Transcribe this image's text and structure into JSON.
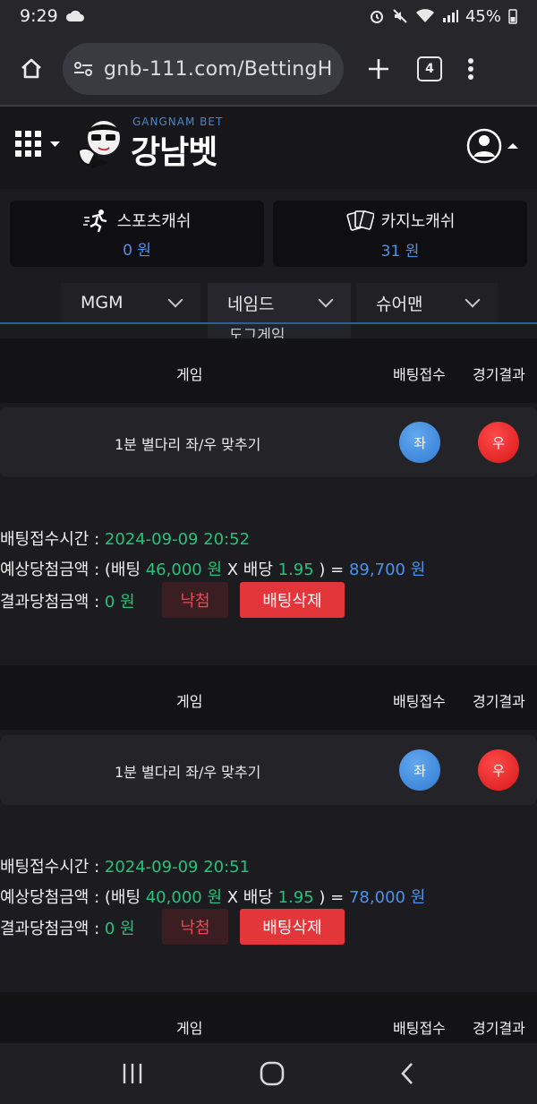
{
  "status_bar": {
    "time": "9:29",
    "battery": "45%"
  },
  "browser": {
    "url": "gnb-111.com/BettingH",
    "tab_count": "4"
  },
  "site": {
    "logo_sub": "GANGNAM BET",
    "logo_main": "강남벳"
  },
  "cash": [
    {
      "label": "스포츠캐쉬",
      "value": "0 원"
    },
    {
      "label": "카지노캐쉬",
      "value": "31 원"
    }
  ],
  "filters": [
    "MGM",
    "네임드",
    "슈어맨"
  ],
  "dropdown_peek": "도그게임",
  "table_headers": {
    "game": "게임",
    "betting": "배팅접수",
    "result": "경기결과"
  },
  "bets": [
    {
      "game_name": "1분 별다리 좌/우 맞추기",
      "left_label": "좌",
      "right_label": "우",
      "time_label": "배팅접수시간 : ",
      "time_value": "2024-09-09 20:52",
      "expected_label": "예상당첨금액 : (배팅 ",
      "bet_amount": "46,000 원",
      "x_label": " X 배당 ",
      "odds": "1.95",
      "eq_label": " ) = ",
      "payout": "89,700 원",
      "result_label": "결과당첨금액 : ",
      "result_value": "0 원",
      "lose_label": "낙첨",
      "delete_label": "배팅삭제"
    },
    {
      "game_name": "1분 별다리 좌/우 맞추기",
      "left_label": "좌",
      "right_label": "우",
      "time_label": "배팅접수시간 : ",
      "time_value": "2024-09-09 20:51",
      "expected_label": "예상당첨금액 : (배팅 ",
      "bet_amount": "40,000 원",
      "x_label": " X 배당 ",
      "odds": "1.95",
      "eq_label": " ) = ",
      "payout": "78,000 원",
      "result_label": "결과당첨금액 : ",
      "result_value": "0 원",
      "lose_label": "낙첨",
      "delete_label": "배팅삭제"
    }
  ]
}
